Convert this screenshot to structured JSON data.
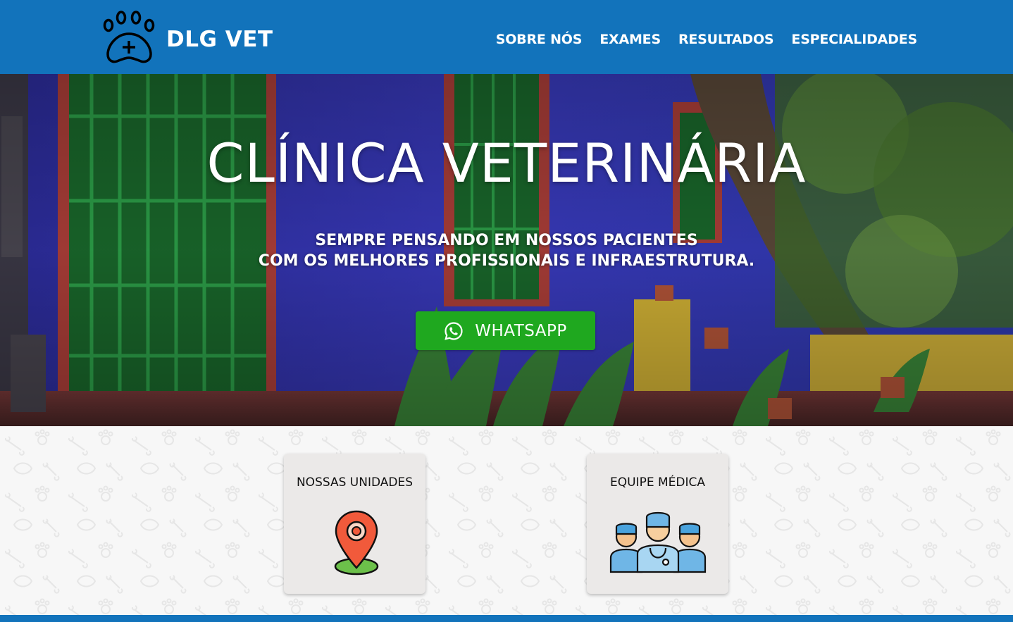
{
  "brand": {
    "name": "DLG VET",
    "logo_icon": "paw-plus-icon",
    "color": "#1273bb"
  },
  "nav": {
    "items": [
      {
        "label": "SOBRE NÓS"
      },
      {
        "label": "EXAMES"
      },
      {
        "label": "RESULTADOS"
      },
      {
        "label": "ESPECIALIDADES"
      }
    ]
  },
  "hero": {
    "title": "CLÍNICA VETERINÁRIA",
    "subtitle_line1": "SEMPRE PENSANDO EM NOSSOS PACIENTES",
    "subtitle_line2": "COM OS MELHORES PROFISSIONAIS E INFRAESTRUTURA.",
    "cta": {
      "label": "WHATSAPP",
      "icon": "whatsapp-icon",
      "color": "#1fa81f"
    }
  },
  "cards": [
    {
      "title": "NOSSAS UNIDADES",
      "icon": "location-pin-icon"
    },
    {
      "title": "EQUIPE MÉDICA",
      "icon": "medical-team-icon"
    }
  ]
}
